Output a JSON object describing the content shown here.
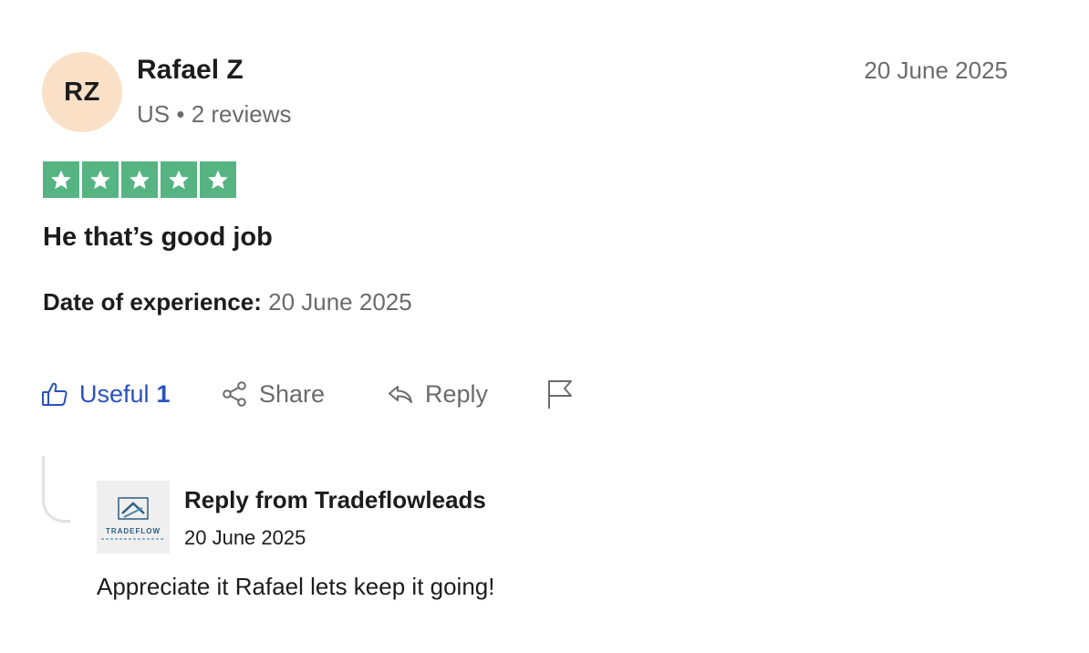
{
  "reviewer": {
    "initials": "RZ",
    "name": "Rafael Z",
    "country": "US",
    "separator": "•",
    "reviews_count": "2 reviews"
  },
  "review": {
    "date": "20 June 2025",
    "rating": 5,
    "rating_max": 5,
    "star_color": "#55b482",
    "title": "He that’s good job",
    "experience_label": "Date of experience:",
    "experience_date": "20 June 2025"
  },
  "actions": {
    "useful_label": "Useful",
    "useful_count": "1",
    "share_label": "Share",
    "reply_label": "Reply",
    "useful_color": "#2a52be"
  },
  "company_reply": {
    "logo_text": "TRADEFLOW",
    "from": "Reply from Tradeflowleads",
    "date": "20 June 2025",
    "body": "Appreciate it Rafael lets keep it going!"
  }
}
